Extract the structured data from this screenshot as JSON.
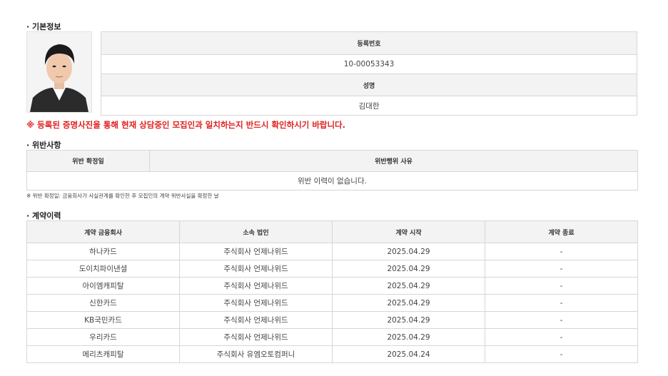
{
  "basic": {
    "title": "· 기본정보",
    "reg_label": "등록번호",
    "reg_value": "10-00053343",
    "name_label": "성명",
    "name_value": "김대한"
  },
  "warning": "※ 등록된 증명사진을 통해 현재 상담중인 모집인과 일치하는지 반드시 확인하시기 바랍니다.",
  "violation": {
    "title": "· 위반사항",
    "col_date": "위반 확정일",
    "col_reason": "위반행위 사유",
    "empty": "위반 이력이 없습니다.",
    "note": "※ 위반 확정일: 금융회사가 사실관계를 확인한 후 모집인의 계약 위반사실을 확정한 날"
  },
  "contracts": {
    "title": "· 계약이력",
    "headers": [
      "계약 금융회사",
      "소속 법인",
      "계약 시작",
      "계약 종료"
    ],
    "rows": [
      [
        "하나카드",
        "주식회사 언제나위드",
        "2025.04.29",
        "-"
      ],
      [
        "도이치파이낸셜",
        "주식회사 언제나위드",
        "2025.04.29",
        "-"
      ],
      [
        "아이엠캐피탈",
        "주식회사 언제나위드",
        "2025.04.29",
        "-"
      ],
      [
        "신한카드",
        "주식회사 언제나위드",
        "2025.04.29",
        "-"
      ],
      [
        "KB국민카드",
        "주식회사 언제나위드",
        "2025.04.29",
        "-"
      ],
      [
        "우리카드",
        "주식회사 언제나위드",
        "2025.04.29",
        "-"
      ],
      [
        "메리츠캐피탈",
        "주식회사 유엠오토컴퍼니",
        "2025.04.24",
        "-"
      ]
    ]
  },
  "colors": {
    "warning": "#e02020",
    "header_bg": "#f3f3f3",
    "border": "#d6d6d6"
  }
}
